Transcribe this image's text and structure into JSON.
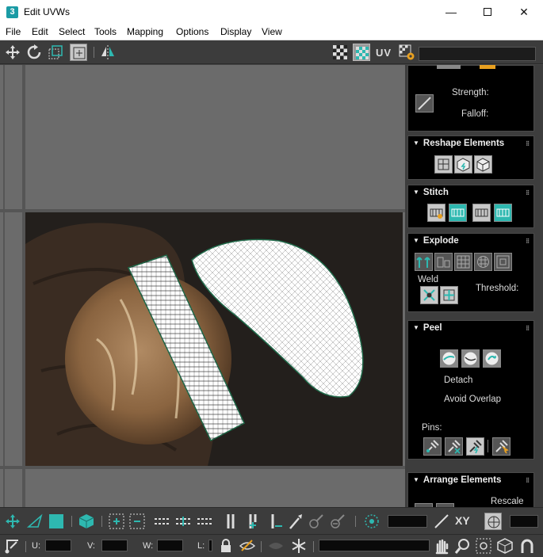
{
  "window": {
    "app_icon": "3",
    "title": "Edit UVWs",
    "minimize": "—",
    "close": "✕"
  },
  "menu": [
    "File",
    "Edit",
    "Select",
    "Tools",
    "Mapping",
    "Options",
    "Display",
    "View"
  ],
  "toolbar_top": {
    "uv_label": "UV"
  },
  "panel": {
    "top": {
      "strength_label": "Strength:",
      "falloff_label": "Falloff:"
    },
    "reshape": {
      "title": "Reshape Elements"
    },
    "stitch": {
      "title": "Stitch"
    },
    "explode": {
      "title": "Explode",
      "weld_label": "Weld",
      "threshold_label": "Threshold:"
    },
    "peel": {
      "title": "Peel",
      "detach_label": "Detach",
      "avoid_overlap_label": "Avoid Overlap",
      "pins_label": "Pins:"
    },
    "arrange": {
      "title": "Arrange Elements",
      "rescale_label": "Rescale"
    }
  },
  "bottom": {
    "xy_label": "XY",
    "u_label": "U:",
    "v_label": "V:",
    "w_label": "W:",
    "l_label": "L:"
  },
  "colors": {
    "accent": "#2eb8b0",
    "panel_bg": "#000000",
    "toolbar_bg": "#3c3c3c",
    "viewport_bg": "#6b6b6b"
  }
}
